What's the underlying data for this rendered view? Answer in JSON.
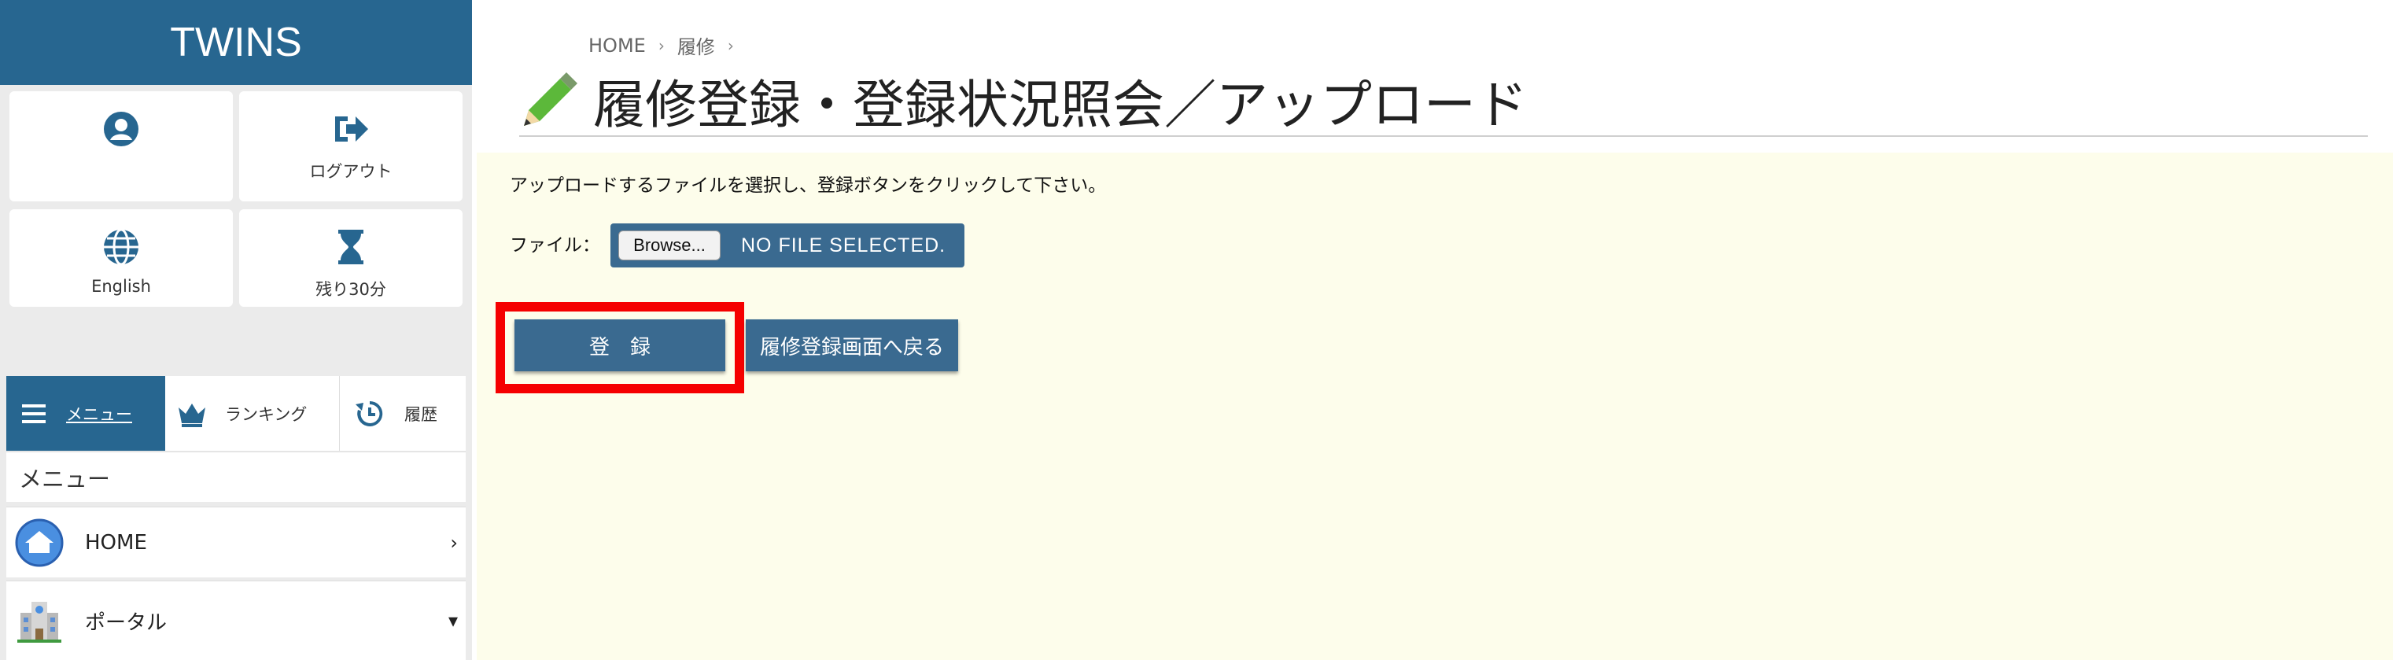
{
  "app": {
    "brand": "TWINS"
  },
  "colors": {
    "primary": "#276690",
    "button": "#3a6a90",
    "highlight": "#f50000",
    "panel_bg": "#fdfdeb"
  },
  "sidebar": {
    "tiles": [
      {
        "icon": "user-circle-icon",
        "label": ""
      },
      {
        "icon": "logout-icon",
        "label": "ログアウト"
      },
      {
        "icon": "globe-icon",
        "label": "English"
      },
      {
        "icon": "hourglass-icon",
        "label": "残り30分"
      }
    ],
    "tabs": [
      {
        "icon": "hamburger-icon",
        "label": "メニュー",
        "active": true
      },
      {
        "icon": "crown-icon",
        "label": "ランキング"
      },
      {
        "icon": "history-icon",
        "label": "履歴"
      }
    ],
    "menu_heading": "メニュー",
    "menu_items": [
      {
        "icon": "home-globe-icon",
        "label": "HOME",
        "arrow": "›"
      },
      {
        "icon": "building-icon",
        "label": "ポータル",
        "arrow": "▾"
      }
    ]
  },
  "breadcrumb": {
    "items": [
      "HOME",
      "履修"
    ],
    "separator": "›"
  },
  "page": {
    "title": "履修登録・登録状況照会／アップロード",
    "instruction": "アップロードするファイルを選択し、登録ボタンをクリックして下さい。",
    "file_label": "ファイル：",
    "browse_label": "Browse...",
    "file_status": "NO FILE SELECTED.",
    "register_label": "登録",
    "back_label": "履修登録画面へ戻る"
  }
}
